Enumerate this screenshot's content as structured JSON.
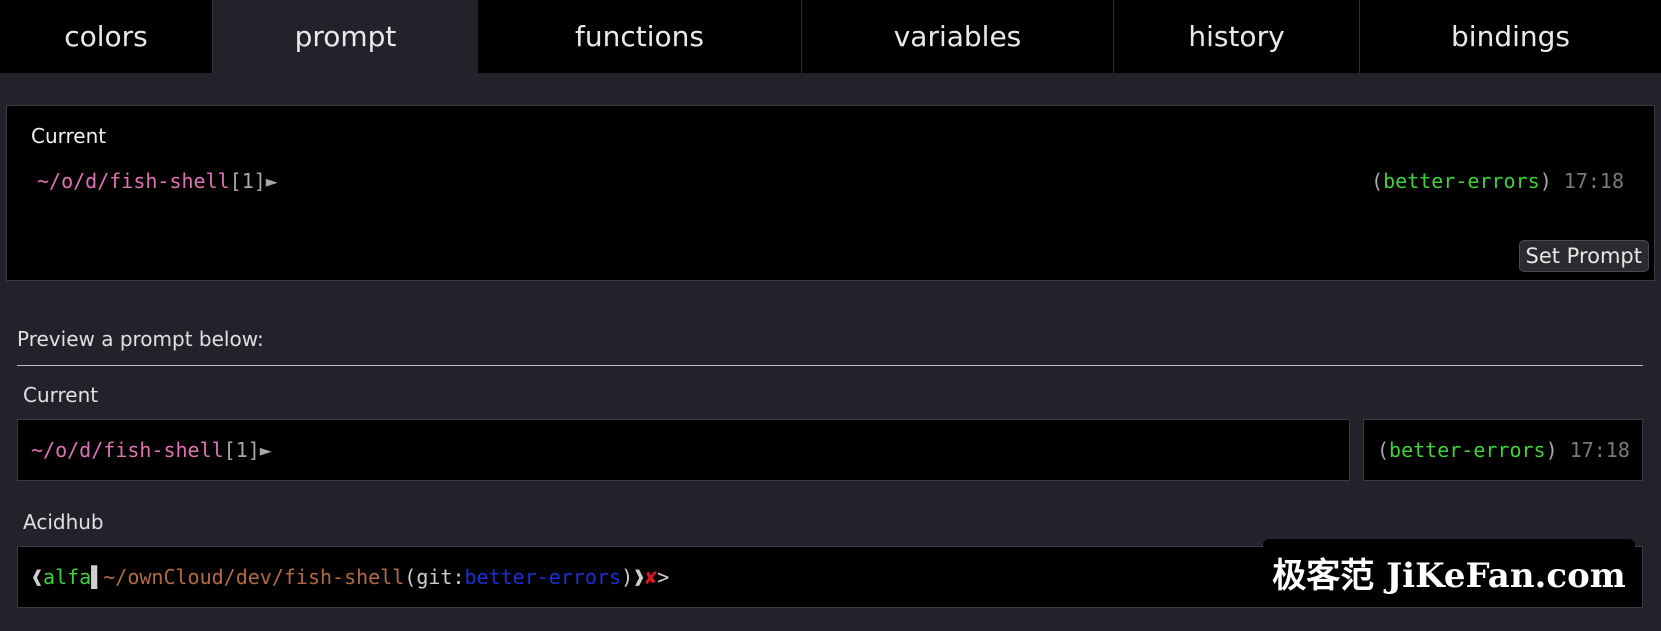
{
  "tabs": [
    {
      "label": "colors"
    },
    {
      "label": "prompt"
    },
    {
      "label": "functions"
    },
    {
      "label": "variables"
    },
    {
      "label": "history"
    },
    {
      "label": "bindings"
    }
  ],
  "active_tab": "prompt",
  "current_panel": {
    "label": "Current",
    "left_path": "~/o/d/fish-shell",
    "left_suffix": "[1]►",
    "right_open": "(",
    "right_branch": "better-errors",
    "right_close": ")",
    "right_time": "17:18",
    "set_button": "Set Prompt"
  },
  "preview": {
    "title": "Preview a prompt below:",
    "items": [
      {
        "label": "Current",
        "left_path": "~/o/d/fish-shell",
        "left_suffix": "[1]►",
        "right_open": "(",
        "right_branch": "better-errors",
        "right_close": ")",
        "right_time": "17:18"
      },
      {
        "label": "Acidhub",
        "open_bracket": "❰",
        "user": "alfa",
        "sep": "▌",
        "path": "~/ownCloud/dev/fish-shell",
        "git_open": "(",
        "git_label": "git:",
        "git_branch": "better-errors",
        "git_close": ")",
        "close_bracket": "❱",
        "status": "✘",
        "arrow": ">"
      }
    ]
  },
  "watermark": "极客范 JiKeFan.com",
  "colors": {
    "background": "#22232a",
    "path_pink": "#e072b4",
    "branch_green": "#3fd13a",
    "acid_brown": "#b26a42",
    "acid_blue": "#1b2fd6",
    "status_red": "#e2171d"
  }
}
